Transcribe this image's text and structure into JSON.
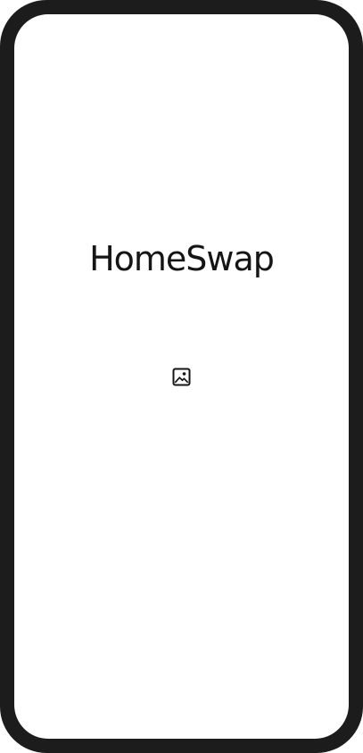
{
  "app": {
    "title": "HomeSwap"
  },
  "splash": {
    "image_icon": "image-placeholder-icon"
  },
  "colors": {
    "frame": "#1c1c1c",
    "screen": "#ffffff",
    "text": "#151515"
  }
}
